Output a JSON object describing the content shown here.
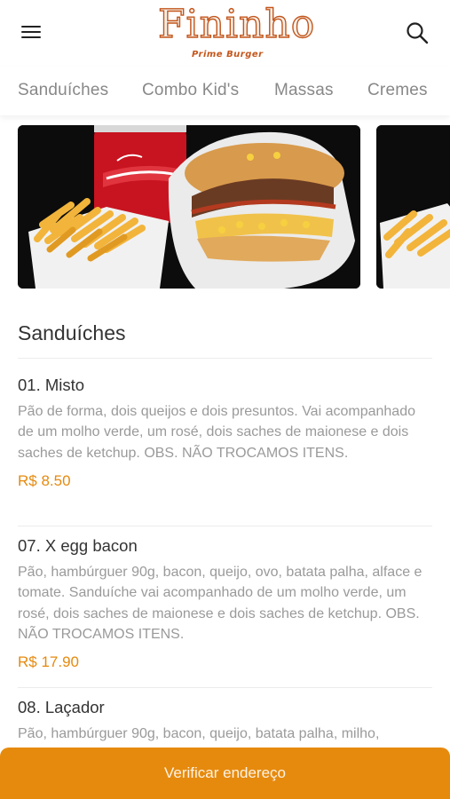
{
  "header": {
    "logo_main": "Fininho",
    "logo_sub": "Prime Burger"
  },
  "tabs": [
    {
      "label": "Sanduíches"
    },
    {
      "label": "Combo Kid's"
    },
    {
      "label": "Massas"
    },
    {
      "label": "Cremes"
    }
  ],
  "section": {
    "title": "Sanduíches"
  },
  "products": [
    {
      "name": "01. Misto",
      "description": "Pão de forma, dois queijos e dois presuntos. Vai acompanhado de um molho verde, um rosé, dois saches de maionese e dois saches de ketchup. OBS. NÃO TROCAMOS ITENS.",
      "price": "R$ 8.50"
    },
    {
      "name": "07. X egg bacon",
      "description": "Pão, hambúrguer 90g, bacon, queijo, ovo, batata palha, alface e tomate. Sanduíche vai acompanhado de um molho verde, um rosé, dois saches de maionese e dois saches de ketchup. OBS. NÃO TROCAMOS ITENS.",
      "price": "R$ 17.90"
    },
    {
      "name": "08. Laçador",
      "description": "Pão, hambúrguer 90g, bacon, queijo, batata palha, milho,"
    }
  ],
  "cta": {
    "label": "Verificar endereço"
  },
  "colors": {
    "accent": "#e68a0e",
    "price": "#e58a0f",
    "logo": "#c4561c"
  },
  "icons": {
    "menu": "hamburger-menu-icon",
    "search": "search-icon"
  }
}
